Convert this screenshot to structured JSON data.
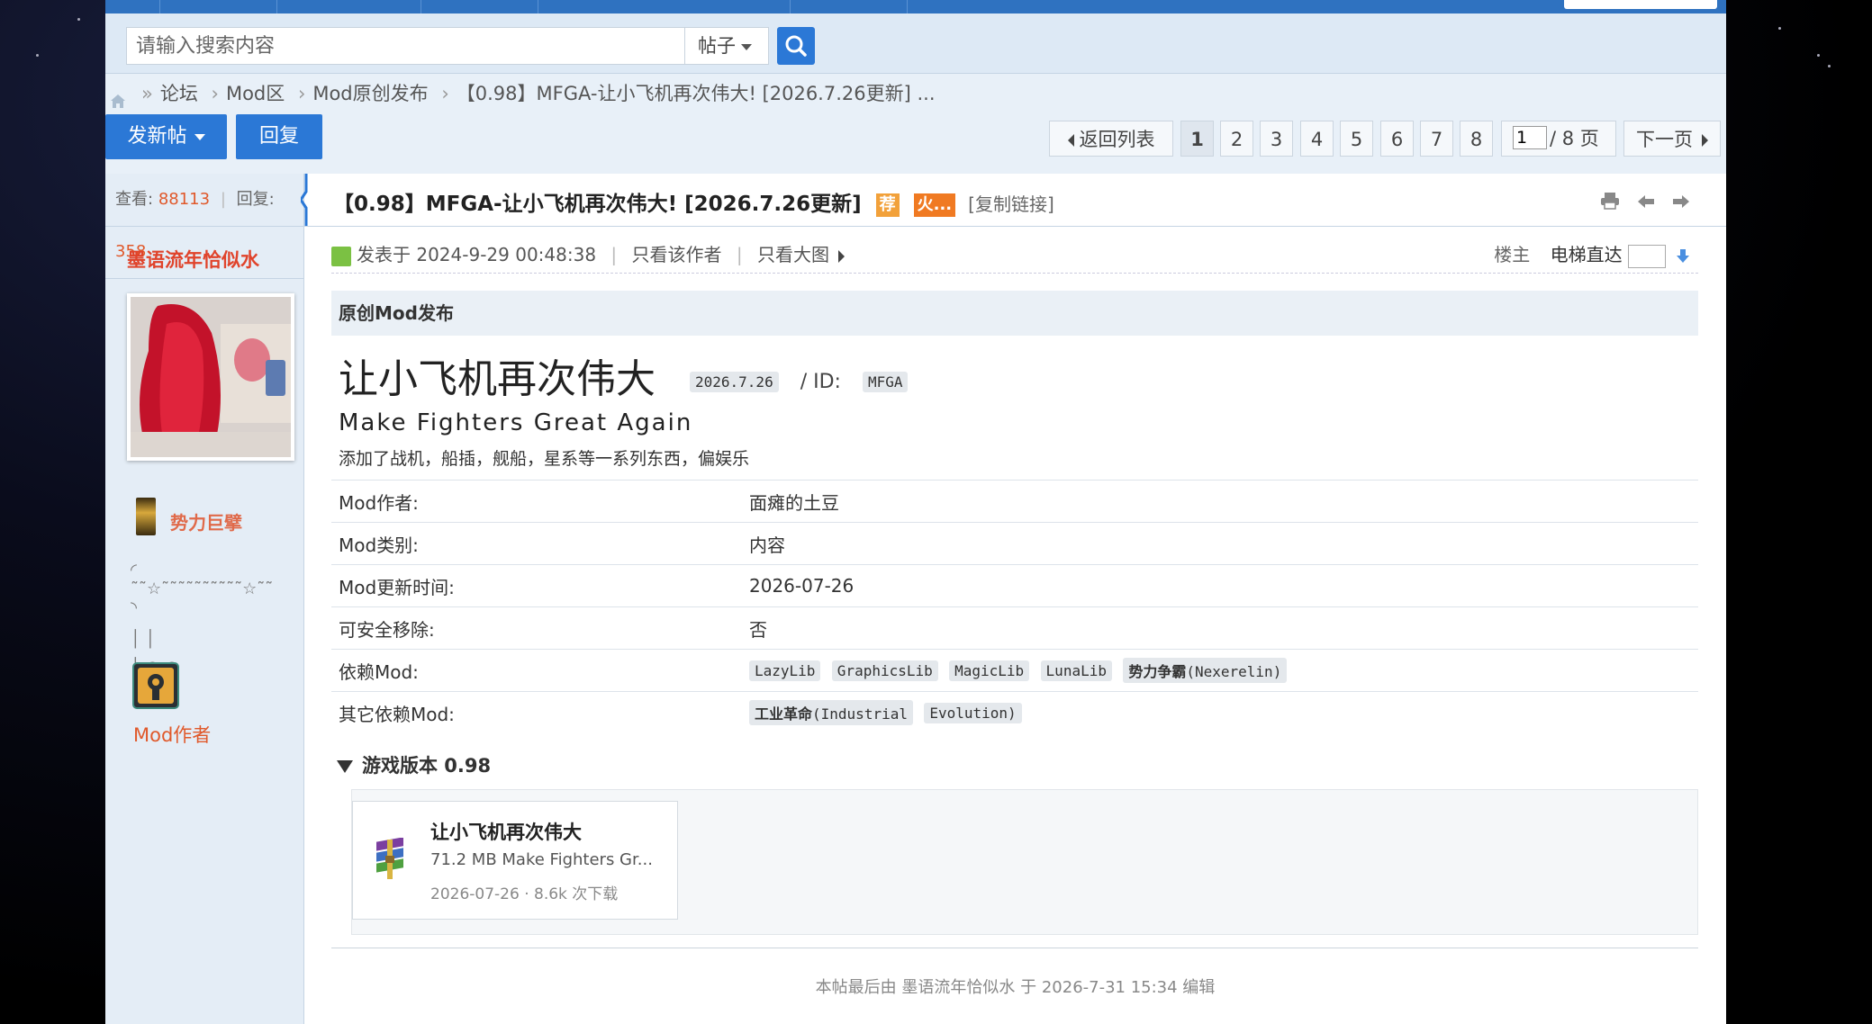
{
  "search": {
    "placeholder": "请输入搜索内容",
    "type_label": "帖子"
  },
  "breadcrumb": {
    "items": [
      "论坛",
      "Mod区",
      "Mod原创发布",
      "【0.98】MFGA-让小飞机再次伟大! [2026.7.26更新] ..."
    ],
    "separator": "›",
    "first_separator": "»"
  },
  "actions": {
    "new_post": "发新帖",
    "reply": "回复"
  },
  "pagination": {
    "back": "返回列表",
    "pages": [
      "1",
      "2",
      "3",
      "4",
      "5",
      "6",
      "7",
      "8"
    ],
    "current": "1",
    "input_value": "1",
    "total": "/ 8 页",
    "next": "下一页"
  },
  "sidebar": {
    "views_label": "查看:",
    "views": "88113",
    "replies_label": "回复:",
    "replies": "358",
    "username": "墨语流年恰似水",
    "rank": "势力巨擘",
    "decoration_top": "◜ ˜˜☆˜˜˜˜˜˜˜˜˜˜☆˜˜ ◝",
    "decoration_mid": "│                                │",
    "decoration_bot": "│     ●         ●",
    "group": "Mod作者"
  },
  "post": {
    "title": "【0.98】MFGA-让小飞机再次伟大! [2026.7.26更新]",
    "tag_recommend": "荐",
    "tag_hot": "火...",
    "copy_link": "[复制链接]",
    "posted_at": "发表于 2024-9-29 00:48:38",
    "only_author": "只看该作者",
    "only_images": "只看大图",
    "floor": "楼主",
    "elevator": "电梯直达",
    "section": "原创Mod发布",
    "mod_title": "让小飞机再次伟大",
    "mod_version": "2026.7.26",
    "id_label": "/ ID:",
    "mod_id": "MFGA",
    "mod_subtitle": "Make Fighters Great Again",
    "mod_desc": "添加了战机，船插，舰船，星系等一系列东西，偏娱乐",
    "info": [
      {
        "key": "Mod作者:",
        "value": "面瘫的土豆"
      },
      {
        "key": "Mod类别:",
        "value": "内容"
      },
      {
        "key": "Mod更新时间:",
        "value": "2026-07-26"
      },
      {
        "key": "可安全移除:",
        "value": "否"
      }
    ],
    "deps_label": "依赖Mod:",
    "deps": [
      "LazyLib",
      "GraphicsLib",
      "MagicLib",
      "LunaLib"
    ],
    "dep_nex_cn": "势力争霸",
    "dep_nex_en": "(Nexerelin)",
    "other_deps_label": "其它依赖Mod:",
    "other_dep_cn": "工业革命",
    "other_dep_en1": "(Industrial",
    "other_dep_en2": "Evolution)",
    "game_version": "游戏版本 0.98",
    "file": {
      "name": "让小飞机再次伟大",
      "info": "71.2 MB  Make Fighters Gr...",
      "meta": "2026-07-26 · 8.6k 次下载"
    },
    "edit_note": "本帖最后由 墨语流年恰似水 于 2026-7-31 15:34 编辑"
  },
  "colors": {
    "accent": "#2b78d6",
    "username": "#e0432b",
    "count": "#e0592b"
  }
}
